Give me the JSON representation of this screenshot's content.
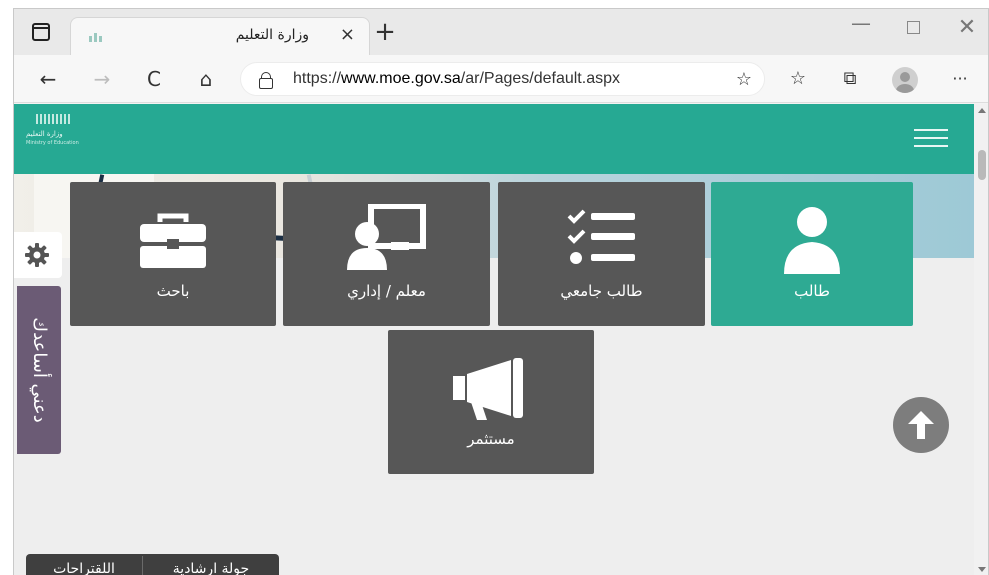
{
  "browser": {
    "tab_title": "وزارة التعليم",
    "tab_close": "×",
    "new_tab": "+",
    "url_prefix": "https://",
    "url_domain": "www.moe.gov.sa",
    "url_path": "/ar/Pages/default.aspx",
    "icons": {
      "back": "←",
      "forward": "→",
      "reload": "C",
      "home": "⌂",
      "favorites_add": "☆",
      "favorites": "☆",
      "collections": "⧉",
      "more": "···",
      "minimize": "—",
      "close": "✕"
    }
  },
  "site": {
    "header_color": "#26a993",
    "logo_text": "وزارة التعليم",
    "logo_subtext": "Ministry of Education"
  },
  "cards": [
    {
      "label": "طالب",
      "icon": "person-icon",
      "active": true
    },
    {
      "label": "طالب جامعي",
      "icon": "checklist-icon",
      "active": false
    },
    {
      "label": "معلم / إداري",
      "icon": "teacher-board-icon",
      "active": false
    },
    {
      "label": "باحث",
      "icon": "briefcase-icon",
      "active": false
    },
    {
      "label": "مستثمر",
      "icon": "megaphone-icon",
      "active": false
    }
  ],
  "sidebar": {
    "help_label": "دعني أساعدك",
    "settings_icon": "gear-icon"
  },
  "bottom_bar": {
    "tour_label": "جولة ارشادية",
    "suggestions_label": "اللقتراحات"
  },
  "colors": {
    "accent": "#2eaa93",
    "card_bg": "#575757",
    "help_bg": "#6b5b75"
  }
}
